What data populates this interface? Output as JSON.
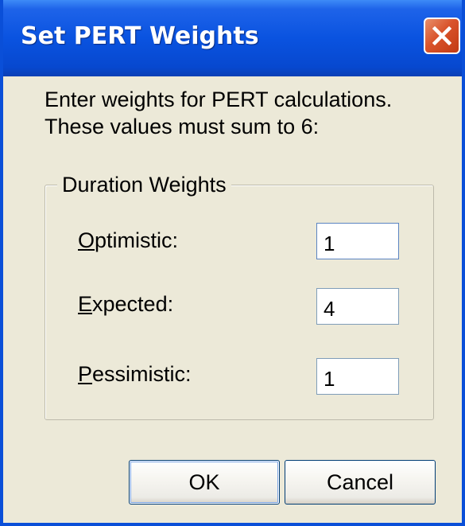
{
  "window": {
    "title": "Set PERT Weights",
    "close_icon": "close-x-icon"
  },
  "instructions": {
    "line1": "Enter weights for PERT calculations.",
    "line2": "These values must sum to 6:"
  },
  "group": {
    "legend": "Duration Weights",
    "fields": [
      {
        "accel": "O",
        "rest": "ptimistic:",
        "value": "1"
      },
      {
        "accel": "E",
        "rest": "xpected:",
        "value": "4"
      },
      {
        "accel": "P",
        "rest": "essimistic:",
        "value": "1"
      }
    ]
  },
  "buttons": {
    "ok": "OK",
    "cancel": "Cancel"
  },
  "colors": {
    "titlebar": "#0A53E0",
    "dialog_bg": "#ECE9D8",
    "close_button": "#D9532B"
  }
}
